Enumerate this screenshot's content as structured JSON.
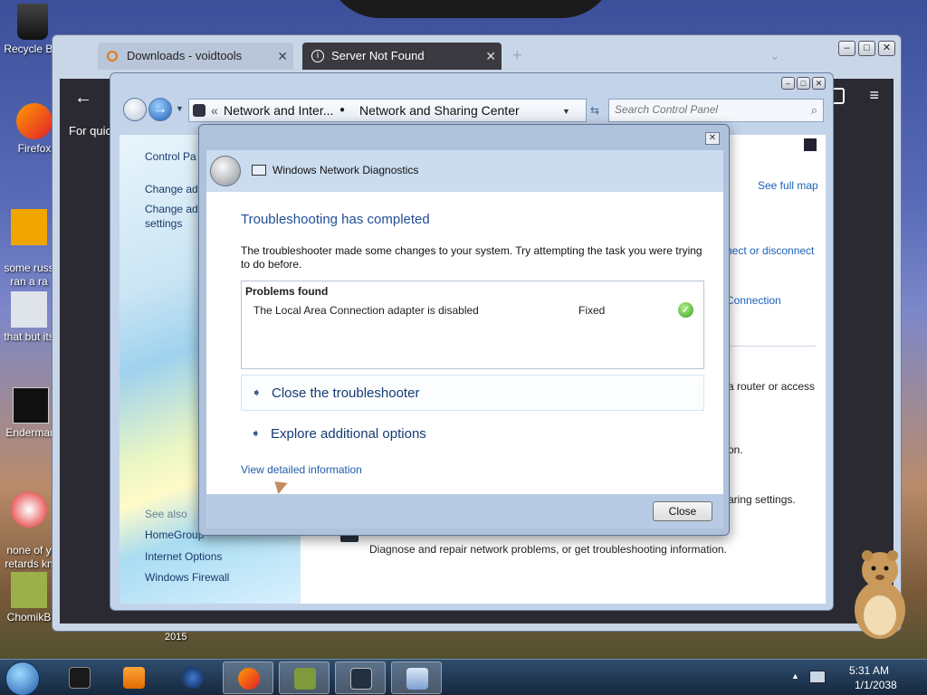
{
  "desktop": {
    "icons": [
      {
        "label": "Recycle Bin",
        "name": "recycle-bin"
      },
      {
        "label": "Firefox",
        "name": "firefox"
      },
      {
        "label": "some russ\nran a ra",
        "name": "some-russ"
      },
      {
        "label": "that but its",
        "name": "that-but-its"
      },
      {
        "label": "Enderman",
        "name": "enderman"
      },
      {
        "label": "none of y\nretards kn",
        "name": "none-of-y"
      },
      {
        "label": "ChomikB",
        "name": "chomikb"
      }
    ],
    "clock_year_label": "2015"
  },
  "browser": {
    "tabs": [
      {
        "label": "Downloads - voidtools",
        "icon": "search-icon"
      },
      {
        "label": "Server Not Found",
        "icon": "info-icon"
      }
    ],
    "quick_text": "For quick",
    "colors": {
      "toolbar": "#2b2a33"
    }
  },
  "control_panel": {
    "breadcrumb": [
      "Network and Inter...",
      "Network and Sharing Center"
    ],
    "search_placeholder": "Search Control Panel",
    "left_links": [
      "Control Pa",
      "Change ada",
      "Change adv\nsettings"
    ],
    "see_also_label": "See also",
    "see_also_links": [
      "HomeGroup",
      "Internet Options",
      "Windows Firewall"
    ],
    "right_links": [
      "See full map",
      "nect or disconnect",
      "Connection"
    ],
    "right_texts": [
      "a router or access",
      "on.",
      "aring settings.",
      "Diagnose and repair network problems, or get troubleshooting information."
    ]
  },
  "dialog": {
    "title": "Windows Network Diagnostics",
    "heading": "Troubleshooting has completed",
    "description": "The troubleshooter made some changes to your system. Try attempting the task you were trying to do before.",
    "problems_header": "Problems found",
    "problems": [
      {
        "name": "The Local Area Connection adapter is disabled",
        "status": "Fixed"
      }
    ],
    "commands": [
      "Close the troubleshooter",
      "Explore additional options"
    ],
    "detail_link": "View detailed information",
    "close_button": "Close",
    "colors": {
      "heading": "#1f4e96",
      "link": "#1f5dad",
      "check": "#34a11c"
    }
  },
  "taskbar": {
    "clock_time": "5:31 AM",
    "clock_date": "1/1/2038",
    "items": [
      "terminal",
      "media-player",
      "globe",
      "firefox",
      "box",
      "monitor",
      "network"
    ]
  }
}
